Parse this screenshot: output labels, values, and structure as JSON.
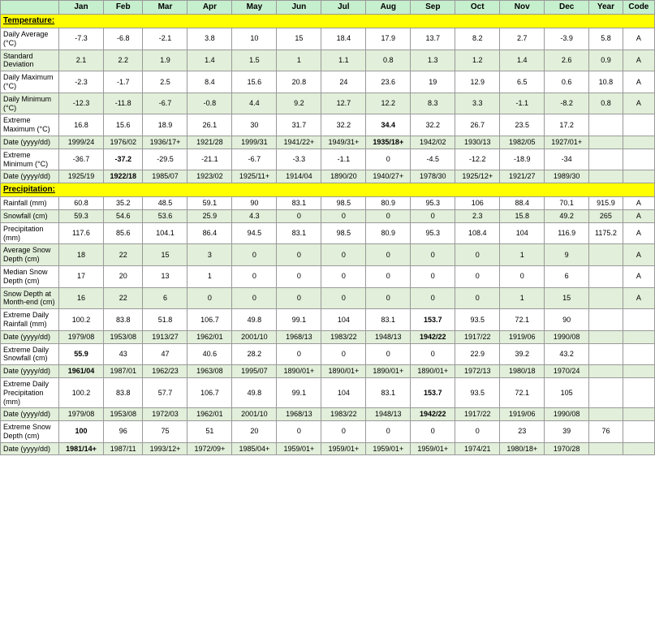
{
  "headers": [
    "",
    "Jan",
    "Feb",
    "Mar",
    "Apr",
    "May",
    "Jun",
    "Jul",
    "Aug",
    "Sep",
    "Oct",
    "Nov",
    "Dec",
    "Year",
    "Code"
  ],
  "sections": {
    "temperature": {
      "label": "Temperature:",
      "rows": [
        {
          "label": "Daily Average (°C)",
          "values": [
            "-7.3",
            "-6.8",
            "-2.1",
            "3.8",
            "10",
            "15",
            "18.4",
            "17.9",
            "13.7",
            "8.2",
            "2.7",
            "-3.9",
            "5.8",
            "A"
          ],
          "style": "row-even"
        },
        {
          "label": "Standard Deviation",
          "values": [
            "2.1",
            "2.2",
            "1.9",
            "1.4",
            "1.5",
            "1",
            "1.1",
            "0.8",
            "1.3",
            "1.2",
            "1.4",
            "2.6",
            "0.9",
            "A"
          ],
          "style": "row-green"
        },
        {
          "label": "Daily Maximum (°C)",
          "values": [
            "-2.3",
            "-1.7",
            "2.5",
            "8.4",
            "15.6",
            "20.8",
            "24",
            "23.6",
            "19",
            "12.9",
            "6.5",
            "0.6",
            "10.8",
            "A"
          ],
          "style": "row-even"
        },
        {
          "label": "Daily Minimum (°C)",
          "values": [
            "-12.3",
            "-11.8",
            "-6.7",
            "-0.8",
            "4.4",
            "9.2",
            "12.7",
            "12.2",
            "8.3",
            "3.3",
            "-1.1",
            "-8.2",
            "0.8",
            "A"
          ],
          "style": "row-green"
        },
        {
          "label": "Extreme Maximum (°C)",
          "values": [
            "16.8",
            "15.6",
            "18.9",
            "26.1",
            "30",
            "31.7",
            "32.2",
            "34.4",
            "32.2",
            "26.7",
            "23.5",
            "17.2",
            "",
            ""
          ],
          "bold_indices": [
            7
          ],
          "style": "row-even"
        },
        {
          "label": "Date (yyyy/dd)",
          "values": [
            "1999/24",
            "1976/02",
            "1936/17+",
            "1921/28",
            "1999/31",
            "1941/22+",
            "1949/31+",
            "1935/18+",
            "1942/02",
            "1930/13",
            "1982/05",
            "1927/01+",
            "",
            ""
          ],
          "bold_indices": [
            7
          ],
          "style": "row-green"
        },
        {
          "label": "Extreme Minimum (°C)",
          "values": [
            "-36.7",
            "-37.2",
            "-29.5",
            "-21.1",
            "-6.7",
            "-3.3",
            "-1.1",
            "0",
            "-4.5",
            "-12.2",
            "-18.9",
            "-34",
            "",
            ""
          ],
          "bold_indices": [
            1
          ],
          "style": "row-even"
        },
        {
          "label": "Date (yyyy/dd)",
          "values": [
            "1925/19",
            "1922/18",
            "1985/07",
            "1923/02",
            "1925/11+",
            "1914/04",
            "1890/20",
            "1940/27+",
            "1978/30",
            "1925/12+",
            "1921/27",
            "1989/30",
            "",
            ""
          ],
          "bold_indices": [
            1
          ],
          "style": "row-green"
        }
      ]
    },
    "precipitation": {
      "label": "Precipitation:",
      "rows": [
        {
          "label": "Rainfall (mm)",
          "values": [
            "60.8",
            "35.2",
            "48.5",
            "59.1",
            "90",
            "83.1",
            "98.5",
            "80.9",
            "95.3",
            "106",
            "88.4",
            "70.1",
            "915.9",
            "A"
          ],
          "style": "row-even"
        },
        {
          "label": "Snowfall (cm)",
          "values": [
            "59.3",
            "54.6",
            "53.6",
            "25.9",
            "4.3",
            "0",
            "0",
            "0",
            "0",
            "2.3",
            "15.8",
            "49.2",
            "265",
            "A"
          ],
          "style": "row-green"
        },
        {
          "label": "Precipitation (mm)",
          "values": [
            "117.6",
            "85.6",
            "104.1",
            "86.4",
            "94.5",
            "83.1",
            "98.5",
            "80.9",
            "95.3",
            "108.4",
            "104",
            "116.9",
            "1175.2",
            "A"
          ],
          "style": "row-even"
        },
        {
          "label": "Average Snow Depth (cm)",
          "values": [
            "18",
            "22",
            "15",
            "3",
            "0",
            "0",
            "0",
            "0",
            "0",
            "0",
            "1",
            "9",
            "",
            "A"
          ],
          "style": "row-green"
        },
        {
          "label": "Median Snow Depth (cm)",
          "values": [
            "17",
            "20",
            "13",
            "1",
            "0",
            "0",
            "0",
            "0",
            "0",
            "0",
            "0",
            "6",
            "",
            "A"
          ],
          "style": "row-even"
        },
        {
          "label": "Snow Depth at Month-end (cm)",
          "values": [
            "16",
            "22",
            "6",
            "0",
            "0",
            "0",
            "0",
            "0",
            "0",
            "0",
            "1",
            "15",
            "",
            "A"
          ],
          "style": "row-green"
        }
      ]
    },
    "extremes": {
      "rows": [
        {
          "label": "Extreme Daily Rainfall (mm)",
          "values": [
            "100.2",
            "83.8",
            "51.8",
            "106.7",
            "49.8",
            "99.1",
            "104",
            "83.1",
            "153.7",
            "93.5",
            "72.1",
            "90",
            "",
            ""
          ],
          "bold_indices": [
            8
          ],
          "style": "row-even"
        },
        {
          "label": "Date (yyyy/dd)",
          "values": [
            "1979/08",
            "1953/08",
            "1913/27",
            "1962/01",
            "2001/10",
            "1968/13",
            "1983/22",
            "1948/13",
            "1942/22",
            "1917/22",
            "1919/06",
            "1990/08",
            "",
            ""
          ],
          "bold_indices": [
            8
          ],
          "style": "row-green"
        },
        {
          "label": "Extreme Daily Snowfall (cm)",
          "values": [
            "55.9",
            "43",
            "47",
            "40.6",
            "28.2",
            "0",
            "0",
            "0",
            "0",
            "22.9",
            "39.2",
            "43.2",
            "",
            ""
          ],
          "bold_indices": [
            0
          ],
          "style": "row-even"
        },
        {
          "label": "Date (yyyy/dd)",
          "values": [
            "1961/04",
            "1987/01",
            "1962/23",
            "1963/08",
            "1995/07",
            "1890/01+",
            "1890/01+",
            "1890/01+",
            "1890/01+",
            "1972/13",
            "1980/18",
            "1970/24",
            "",
            ""
          ],
          "bold_indices": [
            0
          ],
          "style": "row-green"
        },
        {
          "label": "Extreme Daily Precipitation (mm)",
          "values": [
            "100.2",
            "83.8",
            "57.7",
            "106.7",
            "49.8",
            "99.1",
            "104",
            "83.1",
            "153.7",
            "93.5",
            "72.1",
            "105",
            "",
            ""
          ],
          "bold_indices": [
            8
          ],
          "style": "row-even"
        },
        {
          "label": "Date (yyyy/dd)",
          "values": [
            "1979/08",
            "1953/08",
            "1972/03",
            "1962/01",
            "2001/10",
            "1968/13",
            "1983/22",
            "1948/13",
            "1942/22",
            "1917/22",
            "1919/06",
            "1990/08",
            "",
            ""
          ],
          "bold_indices": [
            8
          ],
          "style": "row-green"
        },
        {
          "label": "Extreme Snow Depth (cm)",
          "values": [
            "100",
            "96",
            "75",
            "51",
            "20",
            "0",
            "0",
            "0",
            "0",
            "0",
            "23",
            "39",
            "76",
            ""
          ],
          "bold_indices": [
            0
          ],
          "style": "row-even"
        },
        {
          "label": "Date (yyyy/dd)",
          "values": [
            "1981/14+",
            "1987/11",
            "1993/12+",
            "1972/09+",
            "1985/04+",
            "1959/01+",
            "1959/01+",
            "1959/01+",
            "1959/01+",
            "1974/21",
            "1980/18+",
            "1970/28",
            "",
            ""
          ],
          "bold_indices": [
            0
          ],
          "style": "row-green"
        }
      ]
    }
  }
}
